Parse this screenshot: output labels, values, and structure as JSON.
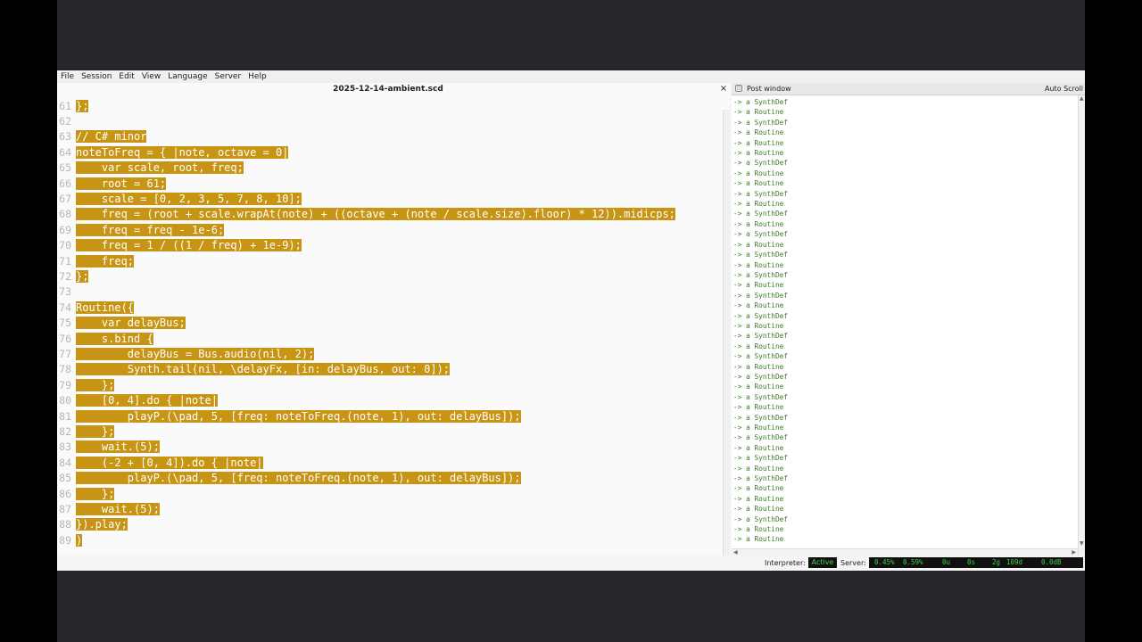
{
  "menu": [
    "File",
    "Session",
    "Edit",
    "View",
    "Language",
    "Server",
    "Help"
  ],
  "document": {
    "title": "2025-12-14-ambient.scd",
    "close_glyph": "×"
  },
  "code_lines": [
    {
      "n": "61",
      "text": "};"
    },
    {
      "n": "62",
      "text": ""
    },
    {
      "n": "63",
      "text": "// C# minor"
    },
    {
      "n": "64",
      "text": "noteToFreq = { |note, octave = 0|"
    },
    {
      "n": "65",
      "text": "    var scale, root, freq;"
    },
    {
      "n": "66",
      "text": "    root = 61;"
    },
    {
      "n": "67",
      "text": "    scale = [0, 2, 3, 5, 7, 8, 10];"
    },
    {
      "n": "68",
      "text": "    freq = (root + scale.wrapAt(note) + ((octave + (note / scale.size).floor) * 12)).midicps;"
    },
    {
      "n": "69",
      "text": "    freq = freq - 1e-6;"
    },
    {
      "n": "70",
      "text": "    freq = 1 / ((1 / freq) + 1e-9);"
    },
    {
      "n": "71",
      "text": "    freq;"
    },
    {
      "n": "72",
      "text": "};"
    },
    {
      "n": "73",
      "text": ""
    },
    {
      "n": "74",
      "text": "Routine({"
    },
    {
      "n": "75",
      "text": "    var delayBus;"
    },
    {
      "n": "76",
      "text": "    s.bind {"
    },
    {
      "n": "77",
      "text": "        delayBus = Bus.audio(nil, 2);"
    },
    {
      "n": "78",
      "text": "        Synth.tail(nil, \\delayFx, [in: delayBus, out: 0]);"
    },
    {
      "n": "79",
      "text": "    };"
    },
    {
      "n": "80",
      "text": "    [0, 4].do { |note|"
    },
    {
      "n": "81",
      "text": "        playP.(\\pad, 5, [freq: noteToFreq.(note, 1), out: delayBus]);"
    },
    {
      "n": "82",
      "text": "    };"
    },
    {
      "n": "83",
      "text": "    wait.(5);"
    },
    {
      "n": "84",
      "text": "    (-2 + [0, 4]).do { |note|"
    },
    {
      "n": "85",
      "text": "        playP.(\\pad, 5, [freq: noteToFreq.(note, 1), out: delayBus]);"
    },
    {
      "n": "86",
      "text": "    };"
    },
    {
      "n": "87",
      "text": "    wait.(5);"
    },
    {
      "n": "88",
      "text": "}).play;"
    },
    {
      "n": "89",
      "text": ")"
    }
  ],
  "post_window": {
    "title": "Post window",
    "auto_scroll_label": "Auto Scroll",
    "lines": [
      "-> a SynthDef",
      "-> a Routine",
      "-> a SynthDef",
      "-> a Routine",
      "-> a Routine",
      "-> a Routine",
      "-> a SynthDef",
      "-> a Routine",
      "-> a Routine",
      "-> a SynthDef",
      "-> a Routine",
      "-> a SynthDef",
      "-> a Routine",
      "-> a SynthDef",
      "-> a Routine",
      "-> a SynthDef",
      "-> a Routine",
      "-> a SynthDef",
      "-> a Routine",
      "-> a SynthDef",
      "-> a Routine",
      "-> a SynthDef",
      "-> a Routine",
      "-> a SynthDef",
      "-> a Routine",
      "-> a SynthDef",
      "-> a Routine",
      "-> a SynthDef",
      "-> a Routine",
      "-> a SynthDef",
      "-> a Routine",
      "-> a SynthDef",
      "-> a Routine",
      "-> a SynthDef",
      "-> a Routine",
      "-> a SynthDef",
      "-> a Routine",
      "-> a SynthDef",
      "-> a Routine",
      "-> a Routine",
      "-> a Routine",
      "-> a SynthDef",
      "-> a Routine",
      "-> a Routine"
    ]
  },
  "status": {
    "interpreter_label": "Interpreter:",
    "interpreter_value": "Active",
    "server_label": "Server:",
    "avg_cpu": "0.45%",
    "peak_cpu": "0.59%",
    "ugens": "0u",
    "synths": "0s",
    "groups": "2g",
    "synthdefs": "109d",
    "volume": "0.0dB"
  }
}
